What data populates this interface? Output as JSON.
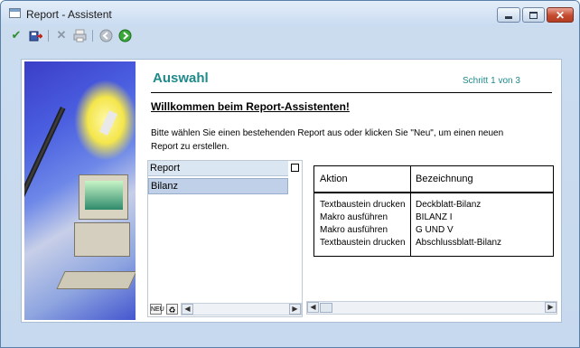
{
  "window": {
    "title": "Report - Assistent"
  },
  "window_controls": {
    "minimize": "minimize-icon",
    "maximize": "maximize-icon",
    "close": "close-icon"
  },
  "toolbar": {
    "icons": [
      "check-icon",
      "save-exit-icon",
      "delete-icon",
      "print-icon",
      "back-icon",
      "forward-icon"
    ]
  },
  "page": {
    "heading": "Auswahl",
    "step": "Schritt 1 von 3",
    "welcome": "Willkommen beim Report-Assistenten!",
    "instruction": "Bitte wählen Sie einen bestehenden Report aus oder klicken Sie \"Neu\", um einen neuen Report zu erstellen."
  },
  "report_list": {
    "header": "Report",
    "items": [
      "Bilanz"
    ],
    "footer_new_label": "NEU"
  },
  "detail_table": {
    "headers": [
      "Aktion",
      "Bezeichnung"
    ],
    "rows": [
      [
        "Textbaustein drucken",
        "Deckblatt-Bilanz"
      ],
      [
        "Makro ausführen",
        "BILANZ I"
      ],
      [
        "Makro ausführen",
        "G UND V"
      ],
      [
        "Textbaustein drucken",
        "Abschlussblatt-Bilanz"
      ]
    ]
  },
  "colors": {
    "accent": "#1f8a8a",
    "selection": "#c0d0e8",
    "close_button": "#c44a2e"
  }
}
